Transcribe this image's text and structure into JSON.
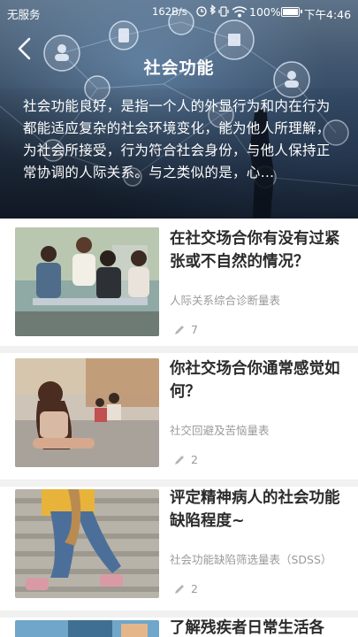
{
  "statusbar": {
    "carrier": "无服务",
    "speed": "162B/s",
    "battery": "100%",
    "time": "下午4:46",
    "icons": [
      "clock-icon",
      "bluetooth-icon",
      "vibrate-icon",
      "wifi-icon"
    ]
  },
  "hero": {
    "title": "社会功能",
    "description": "社会功能良好，是指一个人的外显行为和内在行为都能适应复杂的社会环境变化，能为他人所理解，为社会所接受，行为符合社会身份，与他人保持正常协调的人际关系。与之类似的是，心…",
    "back_icon": "back-arrow-icon"
  },
  "items": [
    {
      "title": "在社交场合你有没有过紧张或不自然的情况？",
      "subtitle": "人际关系综合诊断量表",
      "count": "7",
      "count_icon": "pencil-icon"
    },
    {
      "title": "你社交场合你通常感觉如何？",
      "subtitle": "社交回避及苦恼量表",
      "count": "2",
      "count_icon": "pencil-icon"
    },
    {
      "title": "评定精神病人的社会功能缺陷程度~",
      "subtitle": "社会功能缺陷筛选量表（SDSS）",
      "count": "2",
      "count_icon": "pencil-icon"
    },
    {
      "title": "了解残疾者日常生活各"
    }
  ],
  "colors": {
    "title_text": "#2b2b2b",
    "meta_text": "#9a9a9a",
    "separator": "#f1f1f1"
  }
}
